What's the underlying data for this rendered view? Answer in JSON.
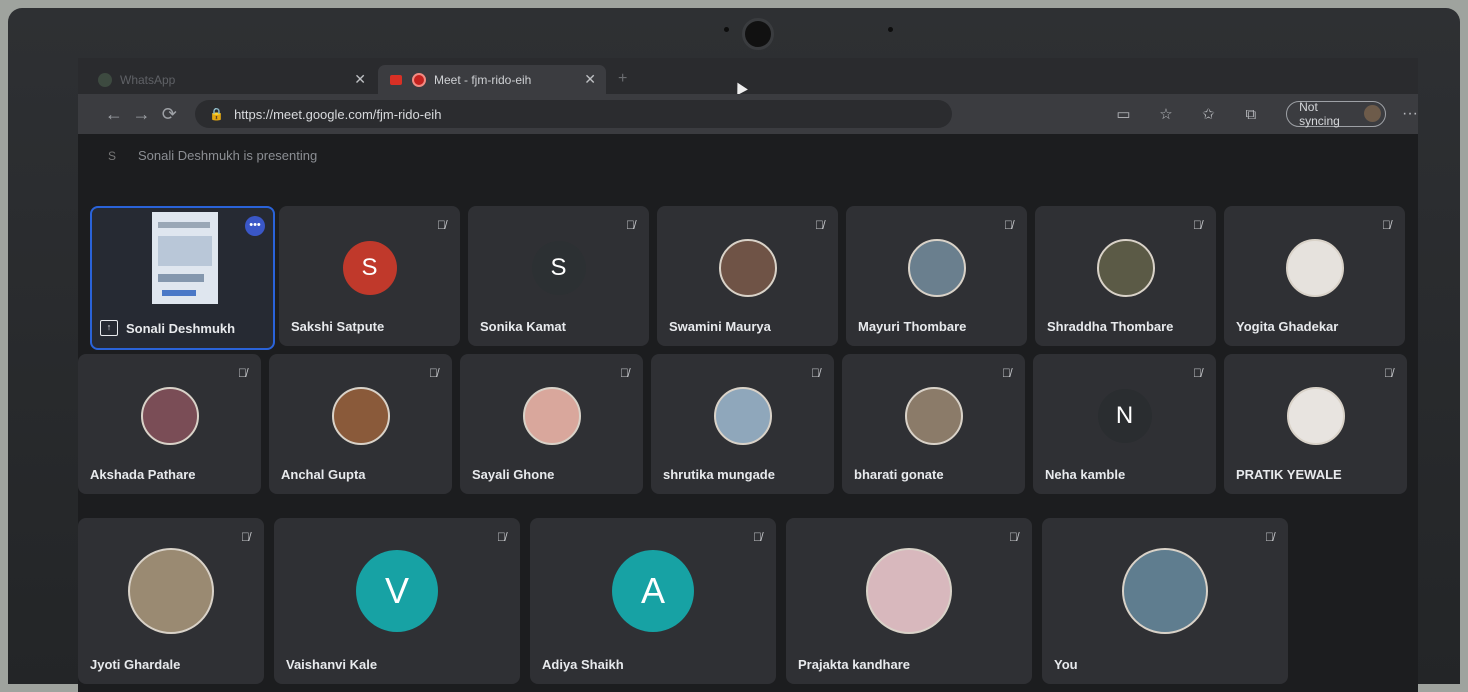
{
  "browser": {
    "tabs": [
      {
        "label": "WhatsApp",
        "active": false
      },
      {
        "label": "Meet - fjm-rido-eih",
        "active": true
      }
    ],
    "url": "https://meet.google.com/fjm-rido-eih",
    "sync_label": "Not syncing"
  },
  "meet": {
    "presenting_text": "Sonali Deshmukh is presenting",
    "presenter_initial": "S",
    "participants": [
      {
        "name": "Sonali Deshmukh",
        "type": "presenting"
      },
      {
        "name": "Sakshi Satpute",
        "type": "initial",
        "initial": "S",
        "color": "#c0392b"
      },
      {
        "name": "Sonika Kamat",
        "type": "initial",
        "initial": "S",
        "color": "#2c3033"
      },
      {
        "name": "Swamini Maurya",
        "type": "photo",
        "color": "#6f5346"
      },
      {
        "name": "Mayuri Thombare",
        "type": "photo",
        "color": "#6a7f8e"
      },
      {
        "name": "Shraddha Thombare",
        "type": "photo",
        "color": "#5b5a46"
      },
      {
        "name": "Yogita Ghadekar",
        "type": "photo",
        "color": "#e6e2dd"
      },
      {
        "name": "Akshada Pathare",
        "type": "photo",
        "color": "#7a4d56"
      },
      {
        "name": "Anchal Gupta",
        "type": "photo",
        "color": "#8a5a3a"
      },
      {
        "name": "Sayali Ghone",
        "type": "photo",
        "color": "#d9a79c"
      },
      {
        "name": "shrutika mungade",
        "type": "photo",
        "color": "#8fa7bb"
      },
      {
        "name": "bharati gonate",
        "type": "photo",
        "color": "#8b7b69"
      },
      {
        "name": "Neha kamble",
        "type": "initial",
        "initial": "N",
        "color": "#2a2d30"
      },
      {
        "name": "PRATIK YEWALE",
        "type": "photo",
        "color": "#e8e4e0"
      },
      {
        "name": "Jyoti Ghardale",
        "type": "photo",
        "color": "#9a8a72"
      },
      {
        "name": "Vaishanvi Kale",
        "type": "initial",
        "initial": "V",
        "color": "#17a2a4"
      },
      {
        "name": "Adiya Shaikh",
        "type": "initial",
        "initial": "A",
        "color": "#17a2a4"
      },
      {
        "name": "Prajakta kandhare",
        "type": "photo",
        "color": "#d8b8bd"
      },
      {
        "name": "You",
        "type": "photo",
        "color": "#5f7d8f"
      }
    ]
  }
}
